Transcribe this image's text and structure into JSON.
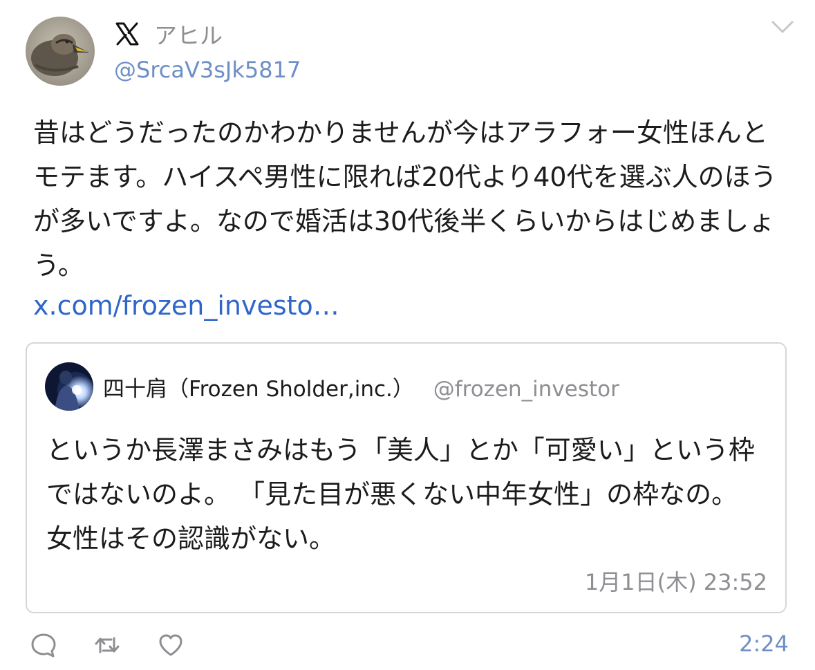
{
  "tweet": {
    "display_name": "アヒル",
    "handle": "@SrcaV3sJk5817",
    "text": "昔はどうだったのかわかりませんが今はアラフォー女性ほんとモテます。ハイスペ男性に限れば20代より40代を選ぶ人のほうが多いですよ。なので婚活は30代後半くらいからはじめましょう。",
    "link": "x.com/frozen_investo…",
    "time": "2:24"
  },
  "quote": {
    "name": "四十肩（Frozen Sholder,inc.）",
    "handle": "@frozen_investor",
    "text": "というか長澤まさみはもう「美人」とか「可愛い」という枠ではないのよ。 「見た目が悪くない中年女性」の枠なの。 女性はその認識がない。",
    "time": "1月1日(木) 23:52"
  },
  "icons": {
    "logo": "x-logo-icon",
    "menu": "chevron-down-icon",
    "reply": "reply-icon",
    "retweet": "retweet-icon",
    "like": "heart-icon"
  },
  "colors": {
    "link": "#2f66c8",
    "handle": "#6d8fc7",
    "muted": "#8e8e93",
    "text": "#1c1c1e"
  }
}
